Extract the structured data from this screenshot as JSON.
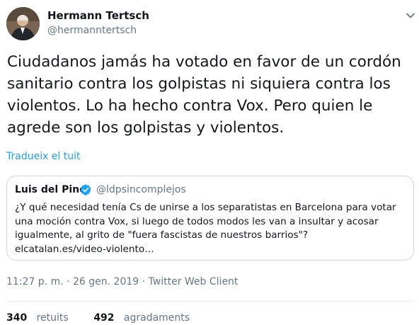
{
  "author": {
    "name": "Hermann Tertsch",
    "handle": "@hermanntertsch",
    "avatar_icon": "user-avatar"
  },
  "menu_icon": "chevron-down-icon",
  "tweet": {
    "text": "Ciudadanos jamás ha votado en favor de un cordón sanitario contra los golpistas ni siquiera contra los violentos. Lo ha hecho contra Vox. Pero quien le agrede son los golpistas y violentos.",
    "translate_label": "Tradueix el tuit"
  },
  "quoted": {
    "name": "Luis del Pino",
    "verified_icon": "verified-badge-icon",
    "handle": "@ldpsincomplejos",
    "text": "¿Y qué necesidad tenía Cs de unirse a los separatistas en Barcelona para votar una moción contra Vox, si luego de todos modos les van a insultar y acosar igualmente, al grito de \"fuera fascistas de nuestros barrios\"?",
    "link": "elcatalan.es/video-violento…"
  },
  "meta": {
    "timestamp": "11:27 p. m. · 26 gen. 2019 · Twitter Web Client"
  },
  "stats": {
    "retweets_count": "340",
    "retweets_label": "retuits",
    "likes_count": "492",
    "likes_label": "agradaments"
  },
  "colors": {
    "link": "#1da1f2",
    "secondary_text": "#657786",
    "border": "#ccd6dd"
  }
}
